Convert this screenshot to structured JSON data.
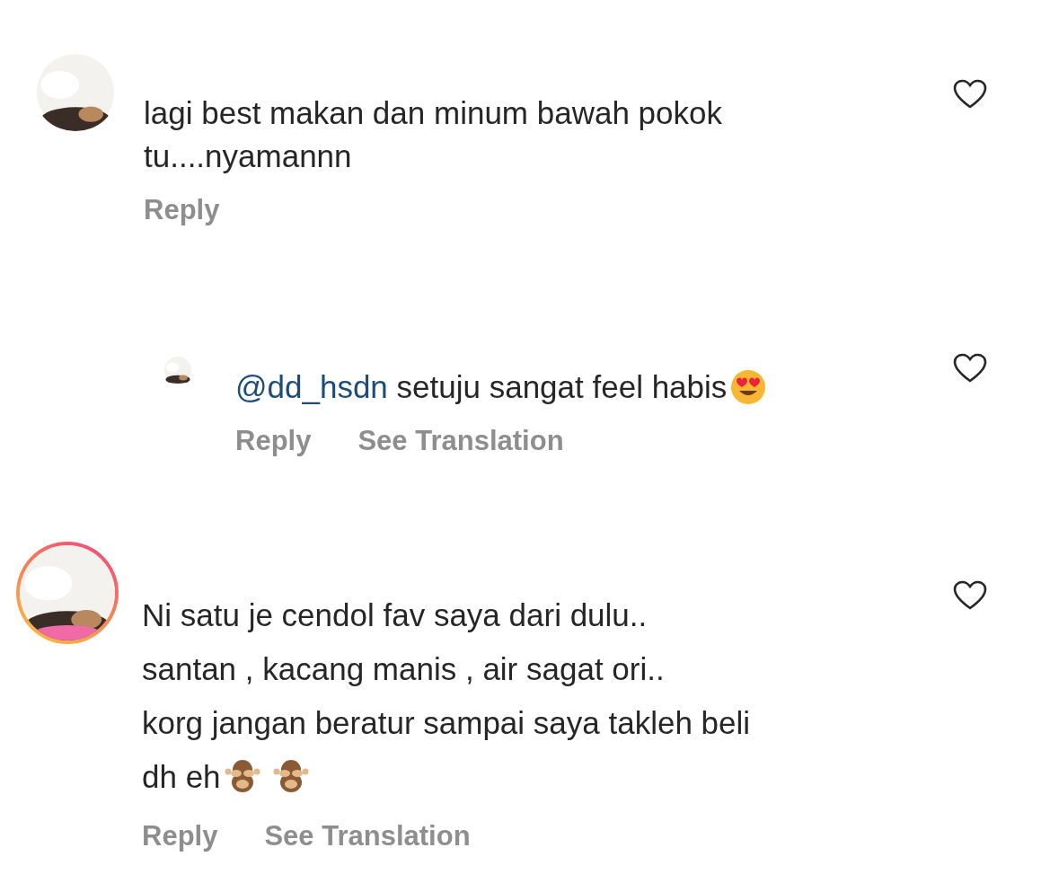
{
  "comments": [
    {
      "kind": "comment",
      "avatar_ring": false,
      "lines": [
        "lagi best makan dan minum bawah pokok",
        "tu....nyamannn"
      ],
      "liked": false,
      "actions": [
        "Reply"
      ]
    },
    {
      "kind": "reply",
      "avatar_ring": false,
      "mention": "@dd_hsdn",
      "lines": [
        "setuju sangat feel habis"
      ],
      "emojis": [
        {
          "kind": "heart-eyes"
        }
      ],
      "liked": false,
      "actions": [
        "Reply",
        "See Translation"
      ]
    },
    {
      "kind": "comment",
      "avatar_ring": true,
      "lines": [
        "Ni satu je cendol fav saya dari dulu..",
        "santan , kacang manis , air sagat ori..",
        "korg jangan beratur sampai saya takleh beli",
        "dh eh"
      ],
      "emojis": [
        {
          "kind": "see-no-evil"
        },
        {
          "kind": "see-no-evil"
        }
      ],
      "liked": false,
      "actions": [
        "Reply",
        "See Translation"
      ]
    }
  ]
}
